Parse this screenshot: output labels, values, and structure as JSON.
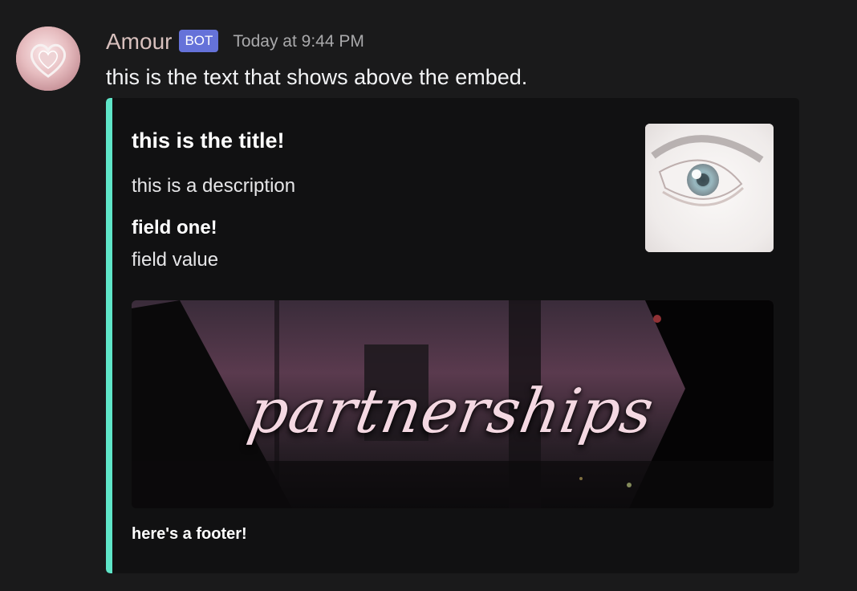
{
  "message": {
    "author": "Amour",
    "bot_tag": "BOT",
    "timestamp": "Today at 9:44 PM",
    "avatar_icon": "heart-crest-avatar-icon",
    "text": "this is the text that shows above the embed."
  },
  "embed": {
    "accent_color": "#5fe5c8",
    "title": "this is the title!",
    "description": "this is a description",
    "fields": [
      {
        "name": "field one!",
        "value": "field value"
      }
    ],
    "thumbnail_icon": "eye-thumbnail-image",
    "image": {
      "caption": "partnerships",
      "icon": "partnerships-banner-image"
    },
    "footer": "here's a footer!"
  },
  "colors": {
    "background": "#1a1a1b",
    "embed_background": "#111112",
    "username": "#d8c0bd",
    "bot_tag": "#6572d9",
    "timestamp": "#a9a9ab"
  }
}
